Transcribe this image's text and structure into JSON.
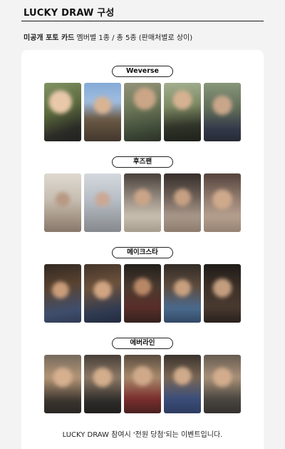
{
  "header": {
    "title": "LUCKY DRAW 구성",
    "subtitle_bold": "미공개 포토 카드",
    "subtitle_rest": " 멤버별 1종 / 총 5종 (판매처별로 상이)"
  },
  "groups": [
    {
      "label": "Weverse",
      "photos": [
        "photo-1",
        "photo-2",
        "photo-3",
        "photo-4",
        "photo-5"
      ]
    },
    {
      "label": "후즈팬",
      "photos": [
        "photo-1",
        "photo-2",
        "photo-3",
        "photo-4",
        "photo-5"
      ]
    },
    {
      "label": "메이크스타",
      "photos": [
        "photo-1",
        "photo-2",
        "photo-3",
        "photo-4",
        "photo-5"
      ]
    },
    {
      "label": "에버라인",
      "photos": [
        "photo-1",
        "photo-2",
        "photo-3",
        "photo-4",
        "photo-5"
      ]
    }
  ],
  "footer": {
    "text": "LUCKY DRAW 참여시 '전원 당첨'되는 이벤트입니다."
  }
}
